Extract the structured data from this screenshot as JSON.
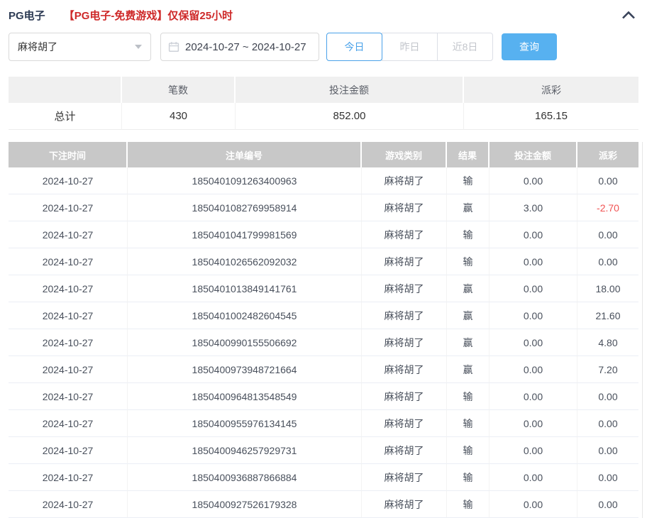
{
  "header": {
    "title": "PG电子",
    "notice": "【PG电子-免费游戏】仅保留25小时"
  },
  "filters": {
    "game_select": {
      "value": "麻将胡了"
    },
    "date_range": {
      "value": "2024-10-27 ~ 2024-10-27"
    },
    "quick_ranges": [
      {
        "label": "今日",
        "active": true
      },
      {
        "label": "昨日",
        "active": false
      },
      {
        "label": "近8日",
        "active": false
      }
    ],
    "search_label": "查询"
  },
  "summary": {
    "headers": [
      "",
      "笔数",
      "投注金额",
      "派彩"
    ],
    "row_label": "总计",
    "count": "430",
    "bet_amount": "852.00",
    "payout": "165.15"
  },
  "records": {
    "headers": [
      "下注时间",
      "注单编号",
      "游戏类别",
      "结果",
      "投注金额",
      "派彩"
    ],
    "rows": [
      {
        "time": "2024-10-27",
        "bet_id": "1850401091263400963",
        "game": "麻将胡了",
        "result": "输",
        "amount": "0.00",
        "payout": "0.00"
      },
      {
        "time": "2024-10-27",
        "bet_id": "1850401082769958914",
        "game": "麻将胡了",
        "result": "赢",
        "amount": "3.00",
        "payout": "-2.70"
      },
      {
        "time": "2024-10-27",
        "bet_id": "1850401041799981569",
        "game": "麻将胡了",
        "result": "输",
        "amount": "0.00",
        "payout": "0.00"
      },
      {
        "time": "2024-10-27",
        "bet_id": "1850401026562092032",
        "game": "麻将胡了",
        "result": "输",
        "amount": "0.00",
        "payout": "0.00"
      },
      {
        "time": "2024-10-27",
        "bet_id": "1850401013849141761",
        "game": "麻将胡了",
        "result": "赢",
        "amount": "0.00",
        "payout": "18.00"
      },
      {
        "time": "2024-10-27",
        "bet_id": "1850401002482604545",
        "game": "麻将胡了",
        "result": "赢",
        "amount": "0.00",
        "payout": "21.60"
      },
      {
        "time": "2024-10-27",
        "bet_id": "1850400990155506692",
        "game": "麻将胡了",
        "result": "赢",
        "amount": "0.00",
        "payout": "4.80"
      },
      {
        "time": "2024-10-27",
        "bet_id": "1850400973948721664",
        "game": "麻将胡了",
        "result": "赢",
        "amount": "0.00",
        "payout": "7.20"
      },
      {
        "time": "2024-10-27",
        "bet_id": "1850400964813548549",
        "game": "麻将胡了",
        "result": "输",
        "amount": "0.00",
        "payout": "0.00"
      },
      {
        "time": "2024-10-27",
        "bet_id": "1850400955976134145",
        "game": "麻将胡了",
        "result": "输",
        "amount": "0.00",
        "payout": "0.00"
      },
      {
        "time": "2024-10-27",
        "bet_id": "1850400946257929731",
        "game": "麻将胡了",
        "result": "输",
        "amount": "0.00",
        "payout": "0.00"
      },
      {
        "time": "2024-10-27",
        "bet_id": "1850400936887866884",
        "game": "麻将胡了",
        "result": "输",
        "amount": "0.00",
        "payout": "0.00"
      },
      {
        "time": "2024-10-27",
        "bet_id": "1850400927526179328",
        "game": "麻将胡了",
        "result": "输",
        "amount": "0.00",
        "payout": "0.00"
      }
    ]
  },
  "colors": {
    "accent_blue": "#57b1f0",
    "active_blue": "#4aa2e9",
    "notice_red": "#ce2929",
    "negative_red": "#f15353",
    "table_header_gray": "#c8c8c8"
  }
}
